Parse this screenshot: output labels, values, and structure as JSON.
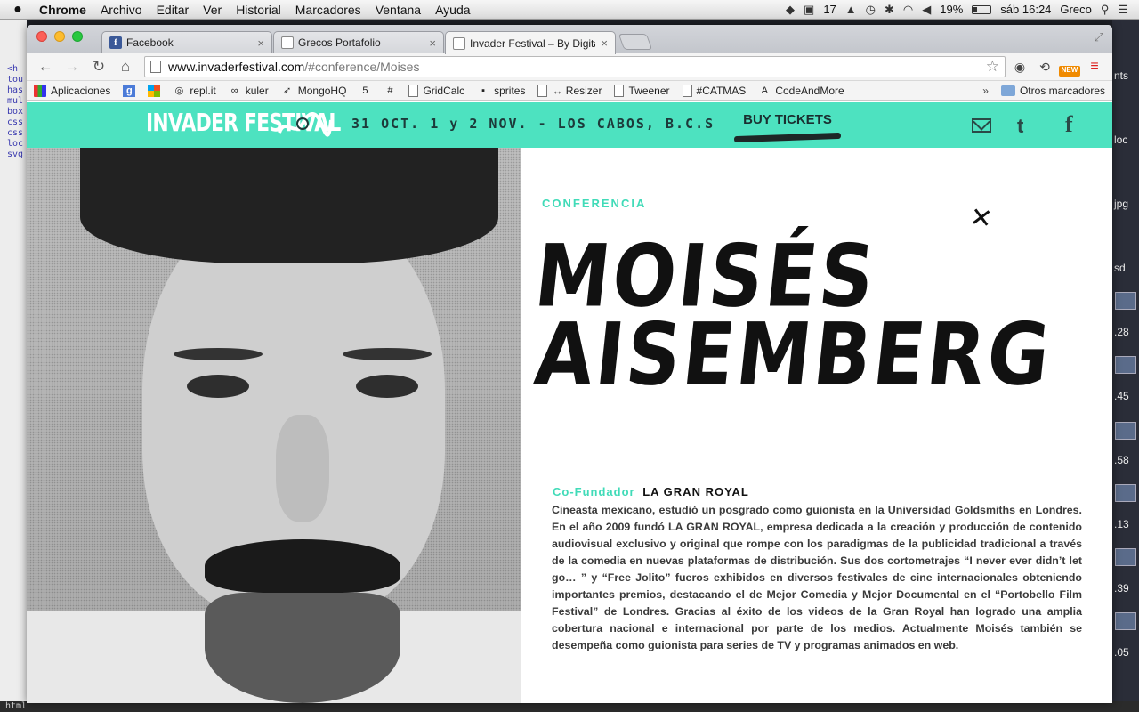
{
  "menubar": {
    "apple": "",
    "app": "Chrome",
    "menus": [
      "Archivo",
      "Editar",
      "Ver",
      "Historial",
      "Marcadores",
      "Ventana",
      "Ayuda"
    ],
    "status": {
      "calendar_count": "17",
      "battery": "19%",
      "clock": "sáb 16:24",
      "user": "Greco"
    }
  },
  "window": {
    "tabs": [
      {
        "title": "Facebook"
      },
      {
        "title": "Grecos Portafolio"
      },
      {
        "title": "Invader Festival – By Digital"
      }
    ],
    "url": {
      "host": "www.invaderfestival.com",
      "path": "/#conference/Moises"
    },
    "bookmarks": [
      "Aplicaciones",
      "repl.it",
      "kuler",
      "MongoHQ",
      "GridCalc",
      "sprites",
      "↔ Resizer",
      "Tweener",
      "#CATMAS",
      "CodeAndMore"
    ],
    "bookmarks_more": "»",
    "other_bookmarks": "Otros marcadores"
  },
  "site": {
    "logo": "INVADER FESTIVAL",
    "dates": "31 OCT. 1 y 2 NOV. - LOS CABOS, B.C.S",
    "buy_tickets": "BUY TICKETS",
    "colors": {
      "accent": "#4de2c0",
      "accent_text": "#41dbb8"
    }
  },
  "speaker": {
    "section": "CONFERENCIA",
    "close": "✕",
    "name_line1": "MOISÉS",
    "name_line2": "AISEMBERG",
    "role": "Co-Fundador",
    "organization": "LA GRAN ROYAL",
    "bio": "Cineasta mexicano, estudió un posgrado como guionista en la Universidad Goldsmiths en Londres. En el año 2009 fundó LA GRAN ROYAL, empresa dedicada a la creación y producción de contenido audiovisual exclusivo y original que rompe con los paradigmas de la publicidad tradicional a través de la comedia en nuevas plataformas de distribución. Sus dos cortometrajes “I never ever didn’t let go… ” y “Free Jolito” fueros exhibidos en diversos festivales de cine internacionales obteniendo importantes premios, destacando el de Mejor Comedia y Mejor Documental en el “Portobello Film Festival” de Londres. Gracias al éxito de los videos de la Gran Royal han logrado una amplia cobertura nacional e internacional por parte de los medios. Actualmente Moisés también se desempeña como guionista para series de TV y programas animados en web."
  },
  "desktop": {
    "left_code": [
      "<h",
      "tou",
      "has",
      "mul",
      "box",
      "css",
      "css",
      "loc",
      "svg"
    ],
    "right_labels": [
      "nts",
      "loc",
      "jpg",
      "sd",
      ".28",
      ".45",
      ".58",
      ".13",
      ".39",
      ".05"
    ],
    "bottom_label": "html"
  }
}
